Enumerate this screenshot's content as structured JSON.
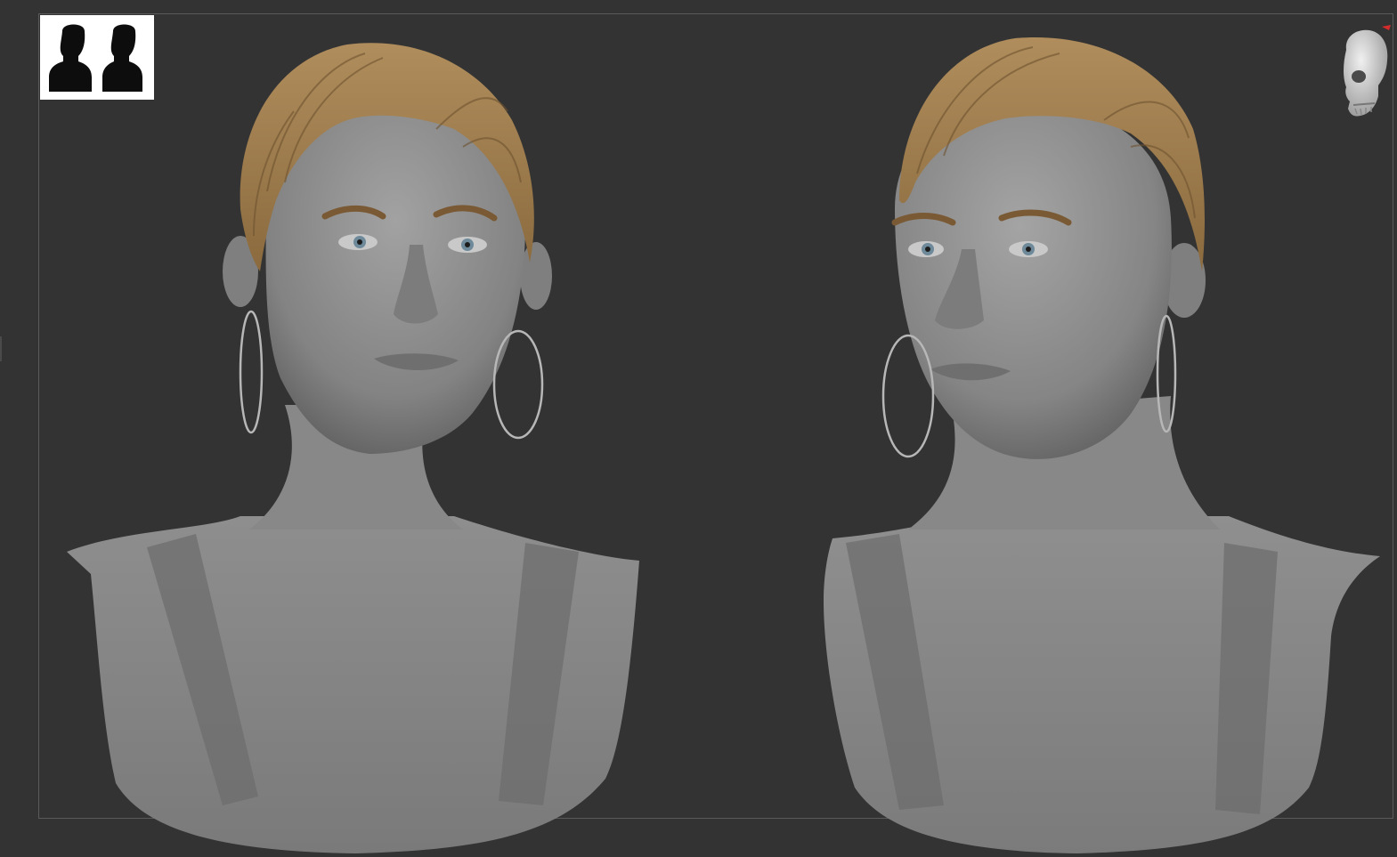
{
  "viewport": {
    "background_color": "#333333",
    "frame_color": "#5a5a5a"
  },
  "reference_thumbnail": {
    "icon": "head-silhouettes-icon",
    "count": 2
  },
  "models": [
    {
      "id": "bust-front",
      "view": "front",
      "hair_color": "#a98656",
      "skin_color": "#8c8c8c",
      "hoop_earrings": 2
    },
    {
      "id": "bust-three-quarter",
      "view": "three-quarter",
      "hair_color": "#a98656",
      "skin_color": "#8c8c8c",
      "hoop_earrings": 2
    }
  ],
  "navigation": {
    "icon": "skull-navcube-icon",
    "axis_color": "#d62b2b"
  }
}
